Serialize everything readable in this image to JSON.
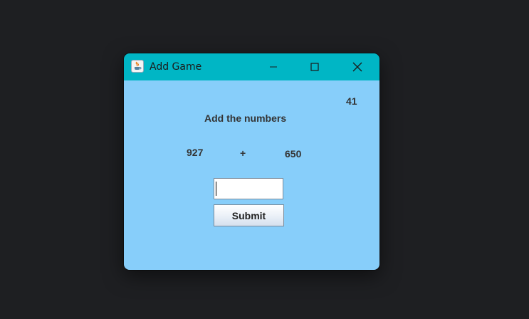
{
  "window": {
    "title": "Add Game",
    "icon": "java-coffee-icon",
    "controls": [
      "minimize-icon",
      "maximize-icon",
      "close-icon"
    ],
    "titlebar_color": "#00b6c5",
    "background_color": "#87cefa"
  },
  "game": {
    "counter": "41",
    "instruction": "Add the numbers",
    "number1": "927",
    "operator": "+",
    "number2": "650"
  },
  "form": {
    "answer_value": "",
    "submit_label": "Submit"
  }
}
